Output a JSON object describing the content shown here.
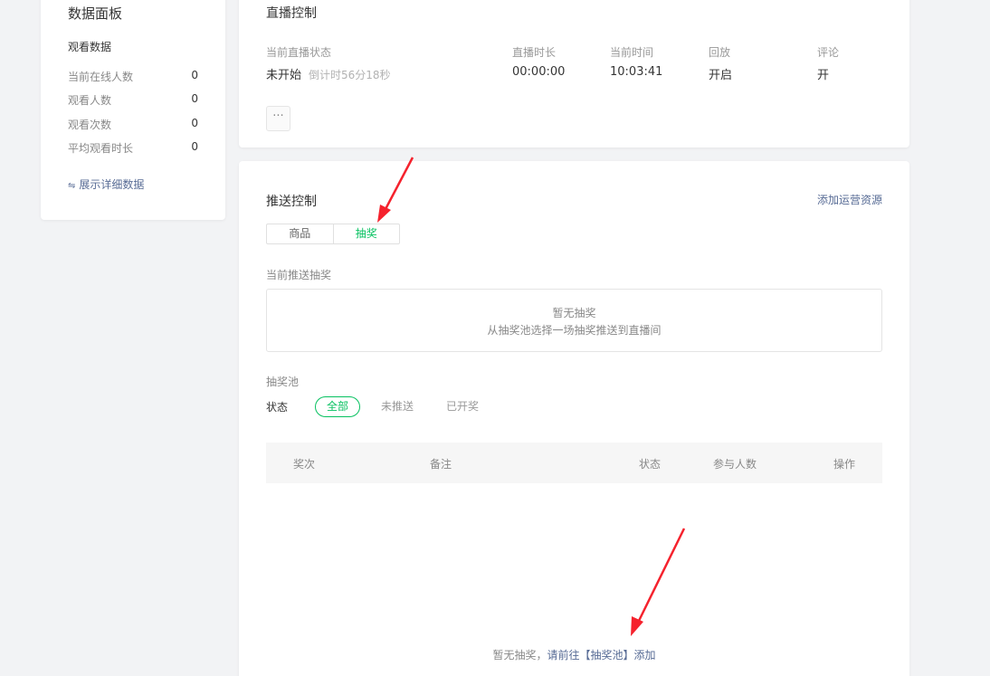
{
  "left_panel": {
    "title": "数据面板",
    "section": "观看数据",
    "rows": [
      {
        "label": "当前在线人数",
        "value": "0"
      },
      {
        "label": "观看人数",
        "value": "0"
      },
      {
        "label": "观看次数",
        "value": "0"
      },
      {
        "label": "平均观看时长",
        "value": "0"
      }
    ],
    "more_link": "展示详细数据",
    "more_icon": "swap-icon"
  },
  "live_control": {
    "title": "直播控制",
    "status": {
      "label": "当前直播状态",
      "value": "未开始",
      "countdown": "倒计时56分18秒"
    },
    "duration": {
      "label": "直播时长",
      "value": "00:00:00"
    },
    "current_time": {
      "label": "当前时间",
      "value": "10:03:41"
    },
    "replay": {
      "label": "回放",
      "value": "开启"
    },
    "comments": {
      "label": "评论",
      "value": "开"
    },
    "more_button": "···"
  },
  "push_control": {
    "title": "推送控制",
    "add_resource": "添加运营资源",
    "tabs": [
      "商品",
      "抽奖"
    ],
    "active_tab": "抽奖",
    "current_label": "当前推送抽奖",
    "empty_title": "暂无抽奖",
    "empty_desc": "从抽奖池选择一场抽奖推送到直播间",
    "pool_label": "抽奖池",
    "filter_label": "状态",
    "filters": [
      "全部",
      "未推送",
      "已开奖"
    ],
    "active_filter": "全部",
    "table_headers": [
      "奖次",
      "备注",
      "状态",
      "参与人数",
      "操作"
    ],
    "bottom_note_prefix": "暂无抽奖，",
    "bottom_note_link": "请前往【抽奖池】添加"
  },
  "colors": {
    "accent": "#07c160",
    "link": "#576b95",
    "arrow": "#f5222d"
  }
}
